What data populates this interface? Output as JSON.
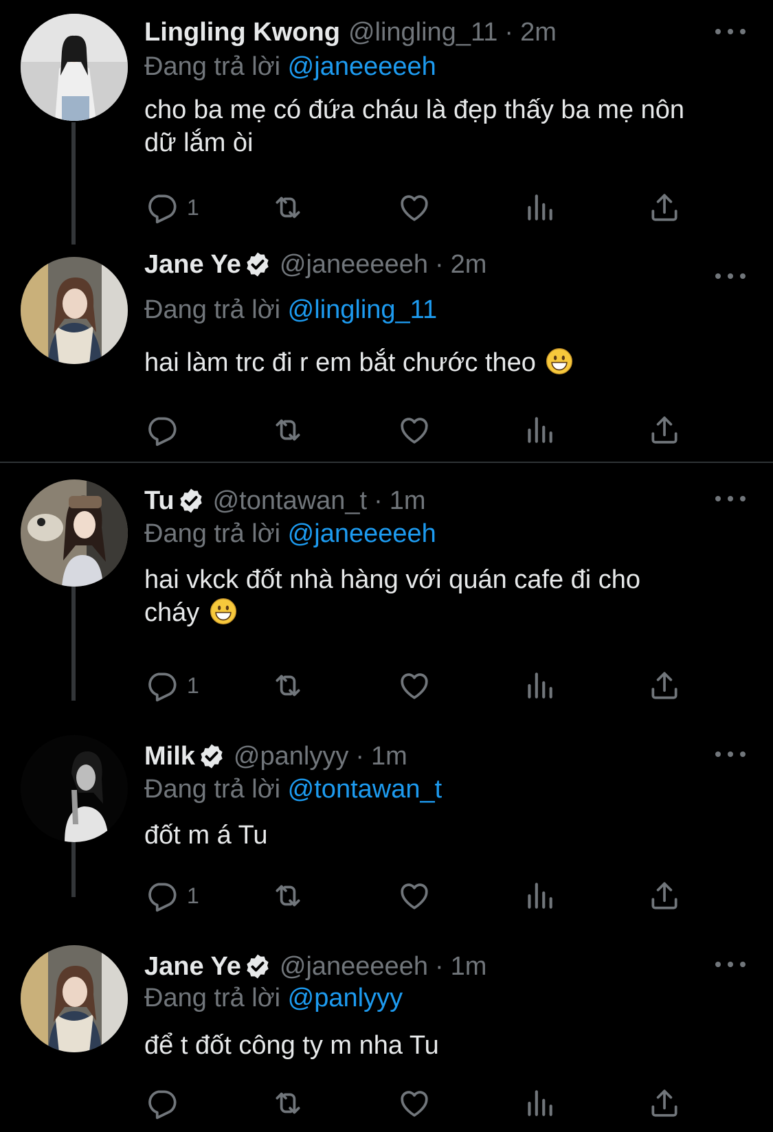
{
  "reply_prefix": "Đang trả lời",
  "tweets": [
    {
      "name": "Lingling Kwong",
      "handle": "@lingling_11",
      "sep": "·",
      "time": "2m",
      "reply_to": "@janeeeeeh",
      "text_lines": [
        "cho ba mẹ có đứa cháu là đẹp thấy ba mẹ nôn",
        "dữ lắm òi"
      ],
      "reply_count": "1",
      "verified": false
    },
    {
      "name": "Jane Ye",
      "handle": "@janeeeeeh",
      "sep": "·",
      "time": "2m",
      "reply_to": "@lingling_11",
      "text_lines": [
        "hai làm trc đi r em bắt chước theo"
      ],
      "reply_count": "",
      "verified": true
    },
    {
      "name": "Tu",
      "handle": "@tontawan_t",
      "sep": "·",
      "time": "1m",
      "reply_to": "@janeeeeeh",
      "text_lines": [
        "hai vkck đốt nhà hàng với quán cafe đi cho",
        "cháy"
      ],
      "reply_count": "1",
      "verified": true
    },
    {
      "name": "Milk",
      "handle": "@panlyyy",
      "sep": "·",
      "time": "1m",
      "reply_to": "@tontawan_t",
      "text_lines": [
        "đốt m á Tu"
      ],
      "reply_count": "1",
      "verified": true
    },
    {
      "name": "Jane Ye",
      "handle": "@janeeeeeh",
      "sep": "·",
      "time": "1m",
      "reply_to": "@panlyyy",
      "text_lines": [
        "để t đốt công ty m nha Tu"
      ],
      "reply_count": "",
      "verified": true
    }
  ],
  "icons": {
    "reply": "reply-icon",
    "retweet": "retweet-icon",
    "like": "heart-icon",
    "views": "views-icon",
    "share": "share-icon",
    "more": "more-icon",
    "verified": "verified-badge-icon",
    "emoji": "smiley-emoji-icon"
  },
  "colors": {
    "background": "#000000",
    "text": "#e7e9ea",
    "muted": "#71767b",
    "accent": "#1d9bf0"
  }
}
